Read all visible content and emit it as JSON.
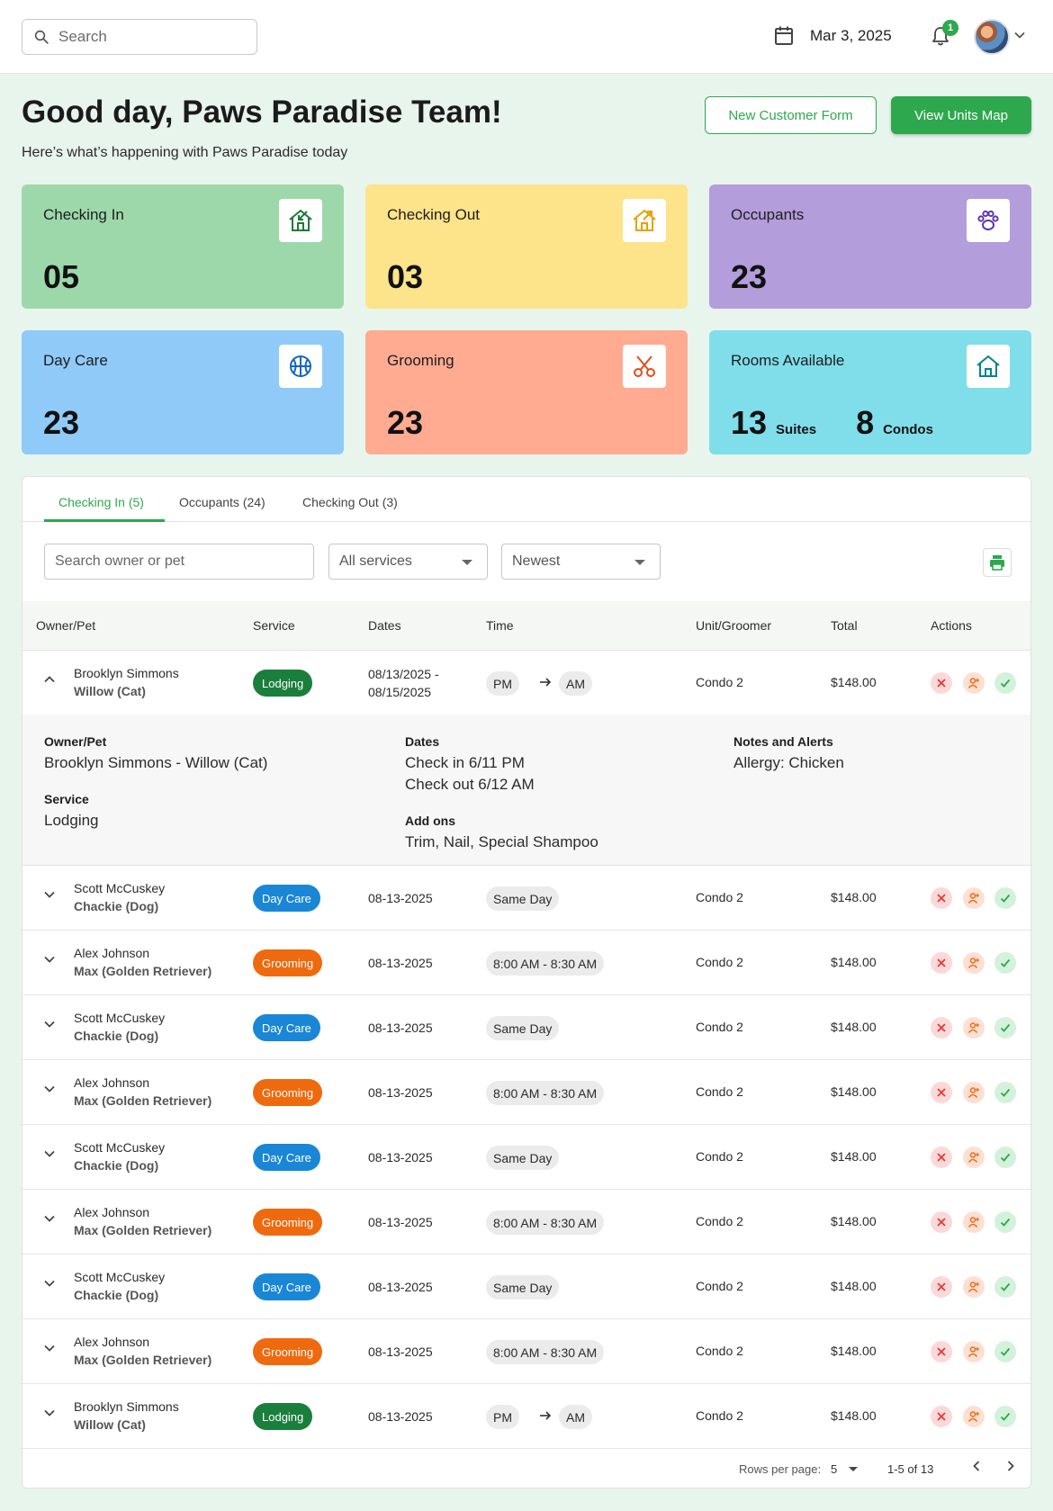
{
  "topbar": {
    "search_placeholder": "Search",
    "date": "Mar 3, 2025",
    "notification_count": "1"
  },
  "header": {
    "greeting": "Good day, Paws Paradise Team!",
    "subtitle": "Here’s what’s happening with Paws Paradise today",
    "new_customer_label": "New Customer Form",
    "view_units_label": "View Units Map"
  },
  "colors": {
    "accent": "#2ea84f",
    "checking_in": "#9dd8aa",
    "checking_out": "#fde38a",
    "occupants": "#b39ddb",
    "day_care": "#90caf9",
    "grooming": "#ffab91",
    "rooms": "#80deea"
  },
  "stats": {
    "checking_in": {
      "label": "Checking In",
      "value": "05",
      "icon": "house-arrow-in-icon"
    },
    "checking_out": {
      "label": "Checking Out",
      "value": "03",
      "icon": "house-arrow-out-icon"
    },
    "occupants": {
      "label": "Occupants",
      "value": "23",
      "icon": "paw-icon"
    },
    "day_care": {
      "label": "Day Care",
      "value": "23",
      "icon": "ball-icon"
    },
    "grooming": {
      "label": "Grooming",
      "value": "23",
      "icon": "scissors-icon"
    },
    "rooms": {
      "label": "Rooms Available",
      "suites_value": "13",
      "suites_label": "Suites",
      "condos_value": "8",
      "condos_label": "Condos",
      "icon": "house-icon"
    }
  },
  "tabs": [
    {
      "label": "Checking In (5)"
    },
    {
      "label": "Occupants (24)"
    },
    {
      "label": "Checking Out (3)"
    }
  ],
  "filters": {
    "search_placeholder": "Search owner or pet",
    "service_selected": "All services",
    "sort_selected": "Newest"
  },
  "columns": [
    "Owner/Pet",
    "Service",
    "Dates",
    "Time",
    "Unit/Groomer",
    "Total",
    "Actions"
  ],
  "rows": [
    {
      "owner": "Brooklyn Simmons",
      "pet": "Willow (Cat)",
      "service": "Lodging",
      "dates": "08/13/2025 -",
      "dates2": "08/15/2025",
      "time_in": "PM",
      "time_out": "AM",
      "unit": "Condo 2",
      "total": "$148.00"
    },
    {
      "owner": "Scott McCuskey",
      "pet": "Chackie (Dog)",
      "service": "Day Care",
      "dates": "08-13-2025",
      "time": "Same Day",
      "unit": "Condo 2",
      "total": "$148.00"
    },
    {
      "owner": "Alex Johnson",
      "pet": "Max (Golden Retriever)",
      "service": "Grooming",
      "dates": "08-13-2025",
      "time": "8:00 AM - 8:30 AM",
      "unit": "Condo 2",
      "total": "$148.00"
    },
    {
      "owner": "Scott McCuskey",
      "pet": "Chackie (Dog)",
      "service": "Day Care",
      "dates": "08-13-2025",
      "time": "Same Day",
      "unit": "Condo 2",
      "total": "$148.00"
    },
    {
      "owner": "Alex Johnson",
      "pet": "Max (Golden Retriever)",
      "service": "Grooming",
      "dates": "08-13-2025",
      "time": "8:00 AM - 8:30 AM",
      "unit": "Condo 2",
      "total": "$148.00"
    },
    {
      "owner": "Scott McCuskey",
      "pet": "Chackie (Dog)",
      "service": "Day Care",
      "dates": "08-13-2025",
      "time": "Same Day",
      "unit": "Condo 2",
      "total": "$148.00"
    },
    {
      "owner": "Alex Johnson",
      "pet": "Max (Golden Retriever)",
      "service": "Grooming",
      "dates": "08-13-2025",
      "time": "8:00 AM - 8:30 AM",
      "unit": "Condo 2",
      "total": "$148.00"
    },
    {
      "owner": "Scott McCuskey",
      "pet": "Chackie (Dog)",
      "service": "Day Care",
      "dates": "08-13-2025",
      "time": "Same Day",
      "unit": "Condo 2",
      "total": "$148.00"
    },
    {
      "owner": "Alex Johnson",
      "pet": "Max (Golden Retriever)",
      "service": "Grooming",
      "dates": "08-13-2025",
      "time": "8:00 AM - 8:30 AM",
      "unit": "Condo 2",
      "total": "$148.00"
    },
    {
      "owner": "Brooklyn Simmons",
      "pet": "Willow (Cat)",
      "service": "Lodging",
      "dates": "08-13-2025",
      "time_in": "PM",
      "time_out": "AM",
      "unit": "Condo 2",
      "total": "$148.00"
    }
  ],
  "detail": {
    "owner_pet_label": "Owner/Pet",
    "owner_pet_value": "Brooklyn Simmons - Willow (Cat)",
    "service_label": "Service",
    "service_value": "Lodging",
    "dates_label": "Dates",
    "check_in": "Check in 6/11 PM",
    "check_out": "Check out 6/12 AM",
    "addons_label": "Add ons",
    "addons_value": "Trim, Nail, Special Shampoo",
    "notes_label": "Notes and Alerts",
    "notes_value": "Allergy: Chicken"
  },
  "pagination": {
    "rows_per_page_label": "Rows per page:",
    "rows_per_page": "5",
    "range": "1-5 of 13"
  }
}
